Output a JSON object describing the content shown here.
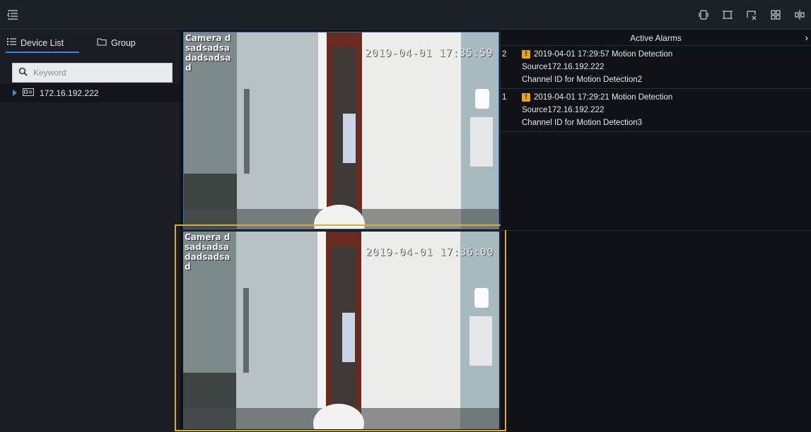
{
  "topbar": {
    "menu_icon": "menu-collapse-icon",
    "icons": [
      "fullscreen-icon",
      "window-fit-icon",
      "close-all-icon",
      "layout-grid-icon",
      "split-icon"
    ]
  },
  "sidebar": {
    "tabs": [
      {
        "label": "Device List",
        "icon": "list-icon"
      },
      {
        "label": "Group",
        "icon": "folder-icon"
      }
    ],
    "search_placeholder": "Keyword",
    "devices": [
      {
        "label": "172.16.192.222",
        "icon": "nvr-device-icon"
      }
    ]
  },
  "videos": [
    {
      "camera": "Camera dsadsadsadadsadsad",
      "timestamp": "2019-04-01 17:35:59"
    },
    {
      "camera": "Camera dsadsadsadadsadsad",
      "timestamp": "2019-04-01 17:36:00"
    }
  ],
  "alarms": {
    "title": "Active Alarms",
    "close": "›",
    "items": [
      {
        "num": "2",
        "line1": "2019-04-01 17:29:57 Motion Detection",
        "source": "Source172.16.192.222",
        "channel": "Channel ID for Motion Detection2"
      },
      {
        "num": "1",
        "line1": "2019-04-01 17:29:21 Motion Detection",
        "source": "Source172.16.192.222",
        "channel": "Channel ID for Motion Detection3"
      }
    ]
  },
  "colors": {
    "accent": "#2e8ee8",
    "selected": "#e6a828",
    "warning": "#e8a21d"
  }
}
